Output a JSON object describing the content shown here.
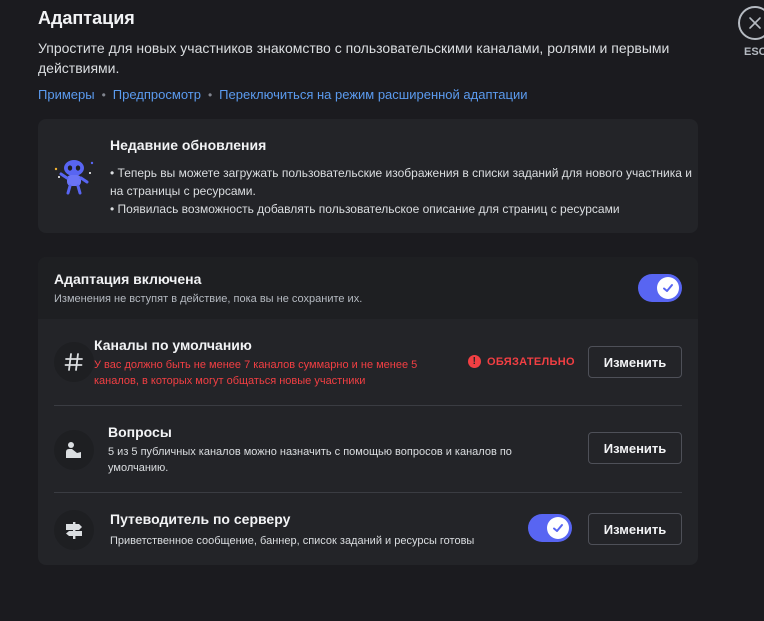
{
  "header": {
    "title": "Адаптация",
    "description": "Упростите для новых участников знакомство с пользовательскими каналами, ролями и первыми действиями.",
    "links": [
      "Примеры",
      "Предпросмотр",
      "Переключиться на режим расширенной адаптации"
    ],
    "separator": "•",
    "close_label": "ESC"
  },
  "updates": {
    "title": "Недавние обновления",
    "items": [
      "• Теперь вы можете загружать пользовательские изображения в списки заданий для нового участника и на страницы с ресурсами.",
      "• Появилась возможность добавлять пользовательское описание для страниц с ресурсами"
    ]
  },
  "onboarding": {
    "title": "Адаптация включена",
    "subtitle": "Изменения не вступят в действие, пока вы не сохраните их.",
    "enabled": true,
    "rows": [
      {
        "title": "Каналы по умолчанию",
        "description": "У вас должно быть не менее 7 каналов суммарно и не менее 5 каналов, в которых могут общаться новые участники",
        "status": "ОБЯЗАТЕЛЬНО",
        "button": "Изменить",
        "icon": "hashtag-icon"
      },
      {
        "title": "Вопросы",
        "description": "5 из 5 публичных каналов можно назначить с помощью вопросов и каналов по умолчанию.",
        "button": "Изменить",
        "icon": "user-questions-icon"
      },
      {
        "title": "Путеводитель по серверу",
        "description": "Приветственное сообщение, баннер, список заданий и ресурсы готовы",
        "enabled": true,
        "button": "Изменить",
        "icon": "signpost-icon"
      }
    ]
  },
  "colors": {
    "accent": "#5865f2",
    "danger": "#f23f43",
    "link": "#5b9bef",
    "background": "#1b1b1f",
    "card": "#232428"
  }
}
